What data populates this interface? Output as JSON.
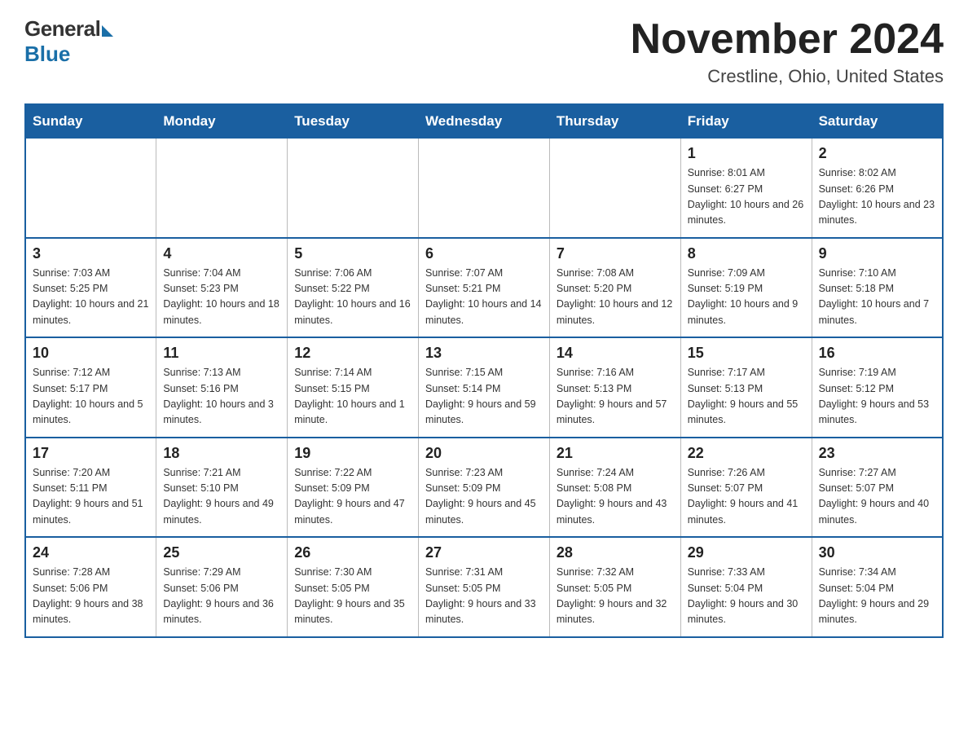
{
  "header": {
    "logo": {
      "general": "General",
      "blue": "Blue"
    },
    "title": "November 2024",
    "location": "Crestline, Ohio, United States"
  },
  "weekdays": [
    "Sunday",
    "Monday",
    "Tuesday",
    "Wednesday",
    "Thursday",
    "Friday",
    "Saturday"
  ],
  "weeks": [
    [
      {
        "day": "",
        "info": ""
      },
      {
        "day": "",
        "info": ""
      },
      {
        "day": "",
        "info": ""
      },
      {
        "day": "",
        "info": ""
      },
      {
        "day": "",
        "info": ""
      },
      {
        "day": "1",
        "info": "Sunrise: 8:01 AM\nSunset: 6:27 PM\nDaylight: 10 hours and 26 minutes."
      },
      {
        "day": "2",
        "info": "Sunrise: 8:02 AM\nSunset: 6:26 PM\nDaylight: 10 hours and 23 minutes."
      }
    ],
    [
      {
        "day": "3",
        "info": "Sunrise: 7:03 AM\nSunset: 5:25 PM\nDaylight: 10 hours and 21 minutes."
      },
      {
        "day": "4",
        "info": "Sunrise: 7:04 AM\nSunset: 5:23 PM\nDaylight: 10 hours and 18 minutes."
      },
      {
        "day": "5",
        "info": "Sunrise: 7:06 AM\nSunset: 5:22 PM\nDaylight: 10 hours and 16 minutes."
      },
      {
        "day": "6",
        "info": "Sunrise: 7:07 AM\nSunset: 5:21 PM\nDaylight: 10 hours and 14 minutes."
      },
      {
        "day": "7",
        "info": "Sunrise: 7:08 AM\nSunset: 5:20 PM\nDaylight: 10 hours and 12 minutes."
      },
      {
        "day": "8",
        "info": "Sunrise: 7:09 AM\nSunset: 5:19 PM\nDaylight: 10 hours and 9 minutes."
      },
      {
        "day": "9",
        "info": "Sunrise: 7:10 AM\nSunset: 5:18 PM\nDaylight: 10 hours and 7 minutes."
      }
    ],
    [
      {
        "day": "10",
        "info": "Sunrise: 7:12 AM\nSunset: 5:17 PM\nDaylight: 10 hours and 5 minutes."
      },
      {
        "day": "11",
        "info": "Sunrise: 7:13 AM\nSunset: 5:16 PM\nDaylight: 10 hours and 3 minutes."
      },
      {
        "day": "12",
        "info": "Sunrise: 7:14 AM\nSunset: 5:15 PM\nDaylight: 10 hours and 1 minute."
      },
      {
        "day": "13",
        "info": "Sunrise: 7:15 AM\nSunset: 5:14 PM\nDaylight: 9 hours and 59 minutes."
      },
      {
        "day": "14",
        "info": "Sunrise: 7:16 AM\nSunset: 5:13 PM\nDaylight: 9 hours and 57 minutes."
      },
      {
        "day": "15",
        "info": "Sunrise: 7:17 AM\nSunset: 5:13 PM\nDaylight: 9 hours and 55 minutes."
      },
      {
        "day": "16",
        "info": "Sunrise: 7:19 AM\nSunset: 5:12 PM\nDaylight: 9 hours and 53 minutes."
      }
    ],
    [
      {
        "day": "17",
        "info": "Sunrise: 7:20 AM\nSunset: 5:11 PM\nDaylight: 9 hours and 51 minutes."
      },
      {
        "day": "18",
        "info": "Sunrise: 7:21 AM\nSunset: 5:10 PM\nDaylight: 9 hours and 49 minutes."
      },
      {
        "day": "19",
        "info": "Sunrise: 7:22 AM\nSunset: 5:09 PM\nDaylight: 9 hours and 47 minutes."
      },
      {
        "day": "20",
        "info": "Sunrise: 7:23 AM\nSunset: 5:09 PM\nDaylight: 9 hours and 45 minutes."
      },
      {
        "day": "21",
        "info": "Sunrise: 7:24 AM\nSunset: 5:08 PM\nDaylight: 9 hours and 43 minutes."
      },
      {
        "day": "22",
        "info": "Sunrise: 7:26 AM\nSunset: 5:07 PM\nDaylight: 9 hours and 41 minutes."
      },
      {
        "day": "23",
        "info": "Sunrise: 7:27 AM\nSunset: 5:07 PM\nDaylight: 9 hours and 40 minutes."
      }
    ],
    [
      {
        "day": "24",
        "info": "Sunrise: 7:28 AM\nSunset: 5:06 PM\nDaylight: 9 hours and 38 minutes."
      },
      {
        "day": "25",
        "info": "Sunrise: 7:29 AM\nSunset: 5:06 PM\nDaylight: 9 hours and 36 minutes."
      },
      {
        "day": "26",
        "info": "Sunrise: 7:30 AM\nSunset: 5:05 PM\nDaylight: 9 hours and 35 minutes."
      },
      {
        "day": "27",
        "info": "Sunrise: 7:31 AM\nSunset: 5:05 PM\nDaylight: 9 hours and 33 minutes."
      },
      {
        "day": "28",
        "info": "Sunrise: 7:32 AM\nSunset: 5:05 PM\nDaylight: 9 hours and 32 minutes."
      },
      {
        "day": "29",
        "info": "Sunrise: 7:33 AM\nSunset: 5:04 PM\nDaylight: 9 hours and 30 minutes."
      },
      {
        "day": "30",
        "info": "Sunrise: 7:34 AM\nSunset: 5:04 PM\nDaylight: 9 hours and 29 minutes."
      }
    ]
  ]
}
